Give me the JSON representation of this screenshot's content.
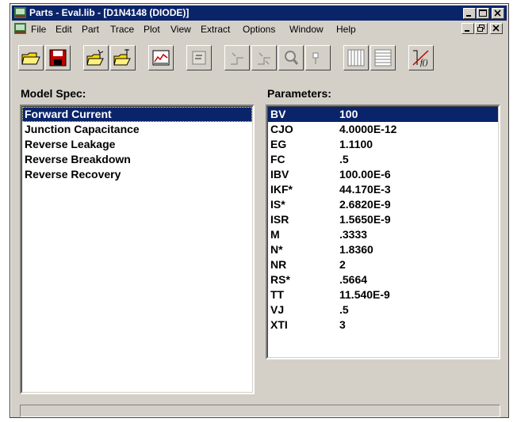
{
  "window": {
    "title": "Parts - Eval.lib - [D1N4148 (DIODE)]",
    "controls": [
      "_",
      "□",
      "×"
    ]
  },
  "menubar": {
    "items": [
      "File",
      "Edit",
      "Part",
      "Trace",
      "Plot",
      "View",
      "Extract",
      "Options",
      "Window",
      "Help"
    ],
    "mdi_controls": [
      "_",
      "▫",
      "×"
    ]
  },
  "toolbar": {
    "buttons": [
      "open-folder-icon",
      "save-disk-icon",
      "new-part-icon",
      "copy-part-icon",
      "plot-icon",
      "edit-icon",
      "trace-icon",
      "trace-dim-icon",
      "zoom-icon",
      "cursor-icon",
      "columns-icon",
      "rows-icon",
      "function-icon"
    ]
  },
  "model_spec": {
    "header": "Model Spec:",
    "items": [
      "Forward Current",
      "Junction Capacitance",
      "Reverse Leakage",
      "Reverse Breakdown",
      "Reverse Recovery"
    ],
    "selected_index": 0
  },
  "parameters": {
    "header": "Parameters:",
    "rows": [
      {
        "name": "BV",
        "value": "100"
      },
      {
        "name": "CJO",
        "value": "4.0000E-12"
      },
      {
        "name": "EG",
        "value": "1.1100"
      },
      {
        "name": "FC",
        "value": ".5"
      },
      {
        "name": "IBV",
        "value": "100.00E-6"
      },
      {
        "name": "IKF*",
        "value": "44.170E-3"
      },
      {
        "name": "IS*",
        "value": "2.6820E-9"
      },
      {
        "name": "ISR",
        "value": "1.5650E-9"
      },
      {
        "name": "M",
        "value": ".3333"
      },
      {
        "name": "N*",
        "value": "1.8360"
      },
      {
        "name": "NR",
        "value": "2"
      },
      {
        "name": "RS*",
        "value": ".5664"
      },
      {
        "name": "TT",
        "value": "11.540E-9"
      },
      {
        "name": "VJ",
        "value": ".5"
      },
      {
        "name": "XTI",
        "value": "3"
      }
    ],
    "selected_index": 0
  },
  "statusbar": {
    "text": ""
  },
  "colors": {
    "titlebar": "#0a246a",
    "selection": "#0a246a",
    "face": "#d4d0c8"
  }
}
